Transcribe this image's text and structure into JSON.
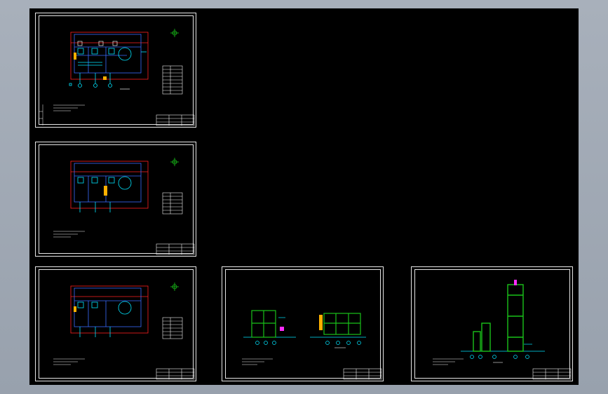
{
  "viewer": {
    "background_color": "#9aa3ae",
    "canvas_color": "#000000"
  },
  "sheets": [
    {
      "id": "sheet-plan-1",
      "kind": "floor-plan"
    },
    {
      "id": "sheet-plan-2",
      "kind": "floor-plan"
    },
    {
      "id": "sheet-plan-3",
      "kind": "floor-plan"
    },
    {
      "id": "sheet-elevations",
      "kind": "elevation"
    },
    {
      "id": "sheet-tower",
      "kind": "elevation"
    }
  ],
  "colors": {
    "frame": "#e6e6e6",
    "red": "#ff2020",
    "cyan": "#00e5ff",
    "blue": "#3a6cff",
    "white": "#f0f0f0",
    "yellow": "#ffb000",
    "green": "#19c219",
    "magenta": "#ff2cff"
  }
}
